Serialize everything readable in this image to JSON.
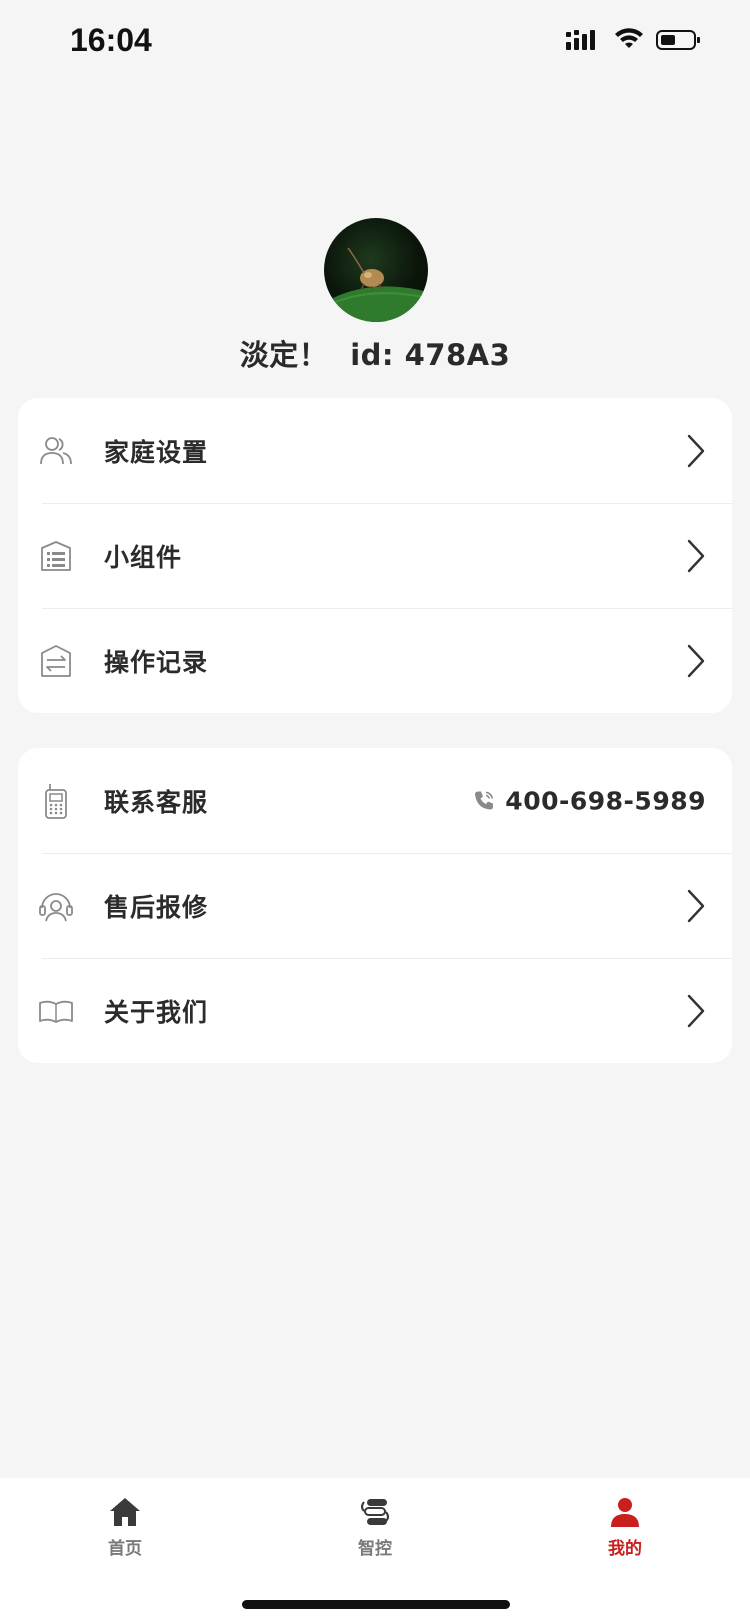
{
  "status_bar": {
    "time": "16:04",
    "icons": [
      "signal-icon",
      "wifi-icon",
      "battery-icon"
    ]
  },
  "profile": {
    "nickname": "淡定！",
    "id_text": "id: 478A3"
  },
  "menu_group_1": [
    {
      "label": "家庭设置",
      "icon": "family-icon"
    },
    {
      "label": "小组件",
      "icon": "widget-icon"
    },
    {
      "label": "操作记录",
      "icon": "records-icon"
    }
  ],
  "menu_group_2": [
    {
      "label": "联系客服",
      "icon": "phone-device-icon",
      "phone": "400-698-5989"
    },
    {
      "label": "售后报修",
      "icon": "support-agent-icon"
    },
    {
      "label": "关于我们",
      "icon": "book-icon"
    }
  ],
  "tab_bar": {
    "tabs": [
      {
        "label": "首页",
        "icon": "home-icon"
      },
      {
        "label": "智控",
        "icon": "smart-control-icon"
      },
      {
        "label": "我的",
        "icon": "user-icon",
        "active": true
      }
    ]
  },
  "colors": {
    "accent": "#c9201e",
    "background": "#f5f5f5",
    "card": "#ffffff"
  }
}
